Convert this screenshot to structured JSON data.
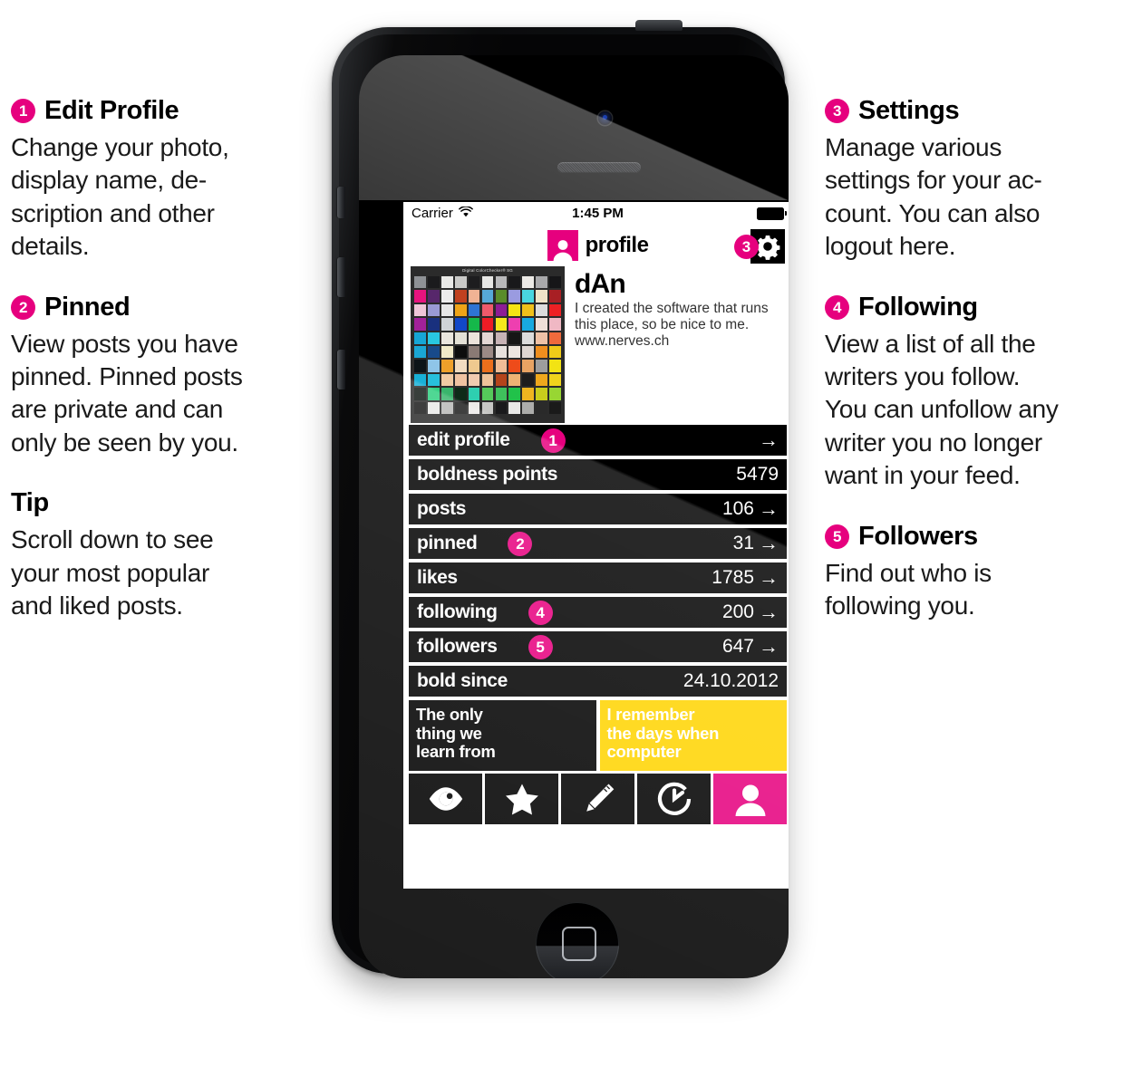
{
  "colors": {
    "accent": "#e6007e",
    "tile_yellow": "#ffd400",
    "black": "#000000"
  },
  "annotations": {
    "left": [
      {
        "number": "1",
        "title": "Edit Profile",
        "lines": [
          "Change your photo,",
          "display name, de-",
          "scription and other",
          "details."
        ]
      },
      {
        "number": "2",
        "title": "Pinned",
        "lines": [
          "View posts you have",
          "pinned. Pinned posts",
          "are private and can",
          "only be seen by you."
        ]
      },
      {
        "number": "",
        "title": "Tip",
        "lines": [
          "Scroll down to see",
          "your most popular",
          "and liked posts."
        ]
      }
    ],
    "right": [
      {
        "number": "3",
        "title": "Settings",
        "lines": [
          "Manage various",
          "settings for your ac-",
          "count. You can also",
          "logout here."
        ]
      },
      {
        "number": "4",
        "title": "Following",
        "lines": [
          "View a list of all the",
          "writers you follow.",
          "You can unfollow any",
          "writer you no longer",
          "want in your feed."
        ]
      },
      {
        "number": "5",
        "title": "Followers",
        "lines": [
          "Find out who is",
          "following you."
        ]
      }
    ]
  },
  "phone": {
    "statusbar": {
      "carrier": "Carrier",
      "wifi_icon": "wifi-icon",
      "time": "1:45 PM",
      "battery_icon": "battery-full-icon"
    },
    "navbar": {
      "profile_icon": "person-icon",
      "title": "profile",
      "settings_icon": "gear-icon",
      "settings_badge": "3"
    },
    "profile": {
      "avatar_alt": "Digital ColorChecker SG",
      "avatar_caption": "Digital ColorChecker® SG",
      "name": "dAn",
      "bio_lines": [
        "I created the software that runs",
        "this place, so be nice to me.",
        "www.nerves.ch"
      ]
    },
    "rows": [
      {
        "label": "edit profile",
        "badge": "1",
        "value": "",
        "arrow": "→"
      },
      {
        "label": "boldness points",
        "badge": "",
        "value": "5479",
        "arrow": ""
      },
      {
        "label": "posts",
        "badge": "",
        "value": "106",
        "arrow": "→"
      },
      {
        "label": "pinned",
        "badge": "2",
        "value": "31",
        "arrow": "→"
      },
      {
        "label": "likes",
        "badge": "",
        "value": "1785",
        "arrow": "→"
      },
      {
        "label": "following",
        "badge": "4",
        "value": "200",
        "arrow": "→"
      },
      {
        "label": "followers",
        "badge": "5",
        "value": "647",
        "arrow": "→"
      },
      {
        "label": "bold since",
        "badge": "",
        "value": "24.10.2012",
        "arrow": ""
      }
    ],
    "tiles": [
      {
        "style": "dark",
        "lines": [
          "The only",
          "thing we",
          "learn from"
        ]
      },
      {
        "style": "yellow",
        "lines": [
          "I remember",
          "the days when",
          "computer"
        ]
      }
    ],
    "tabs": [
      {
        "icon": "eye-icon",
        "active": false
      },
      {
        "icon": "star-icon",
        "active": false
      },
      {
        "icon": "pencil-icon",
        "active": false
      },
      {
        "icon": "clock-icon",
        "active": false
      },
      {
        "icon": "person-icon",
        "active": true
      }
    ]
  }
}
